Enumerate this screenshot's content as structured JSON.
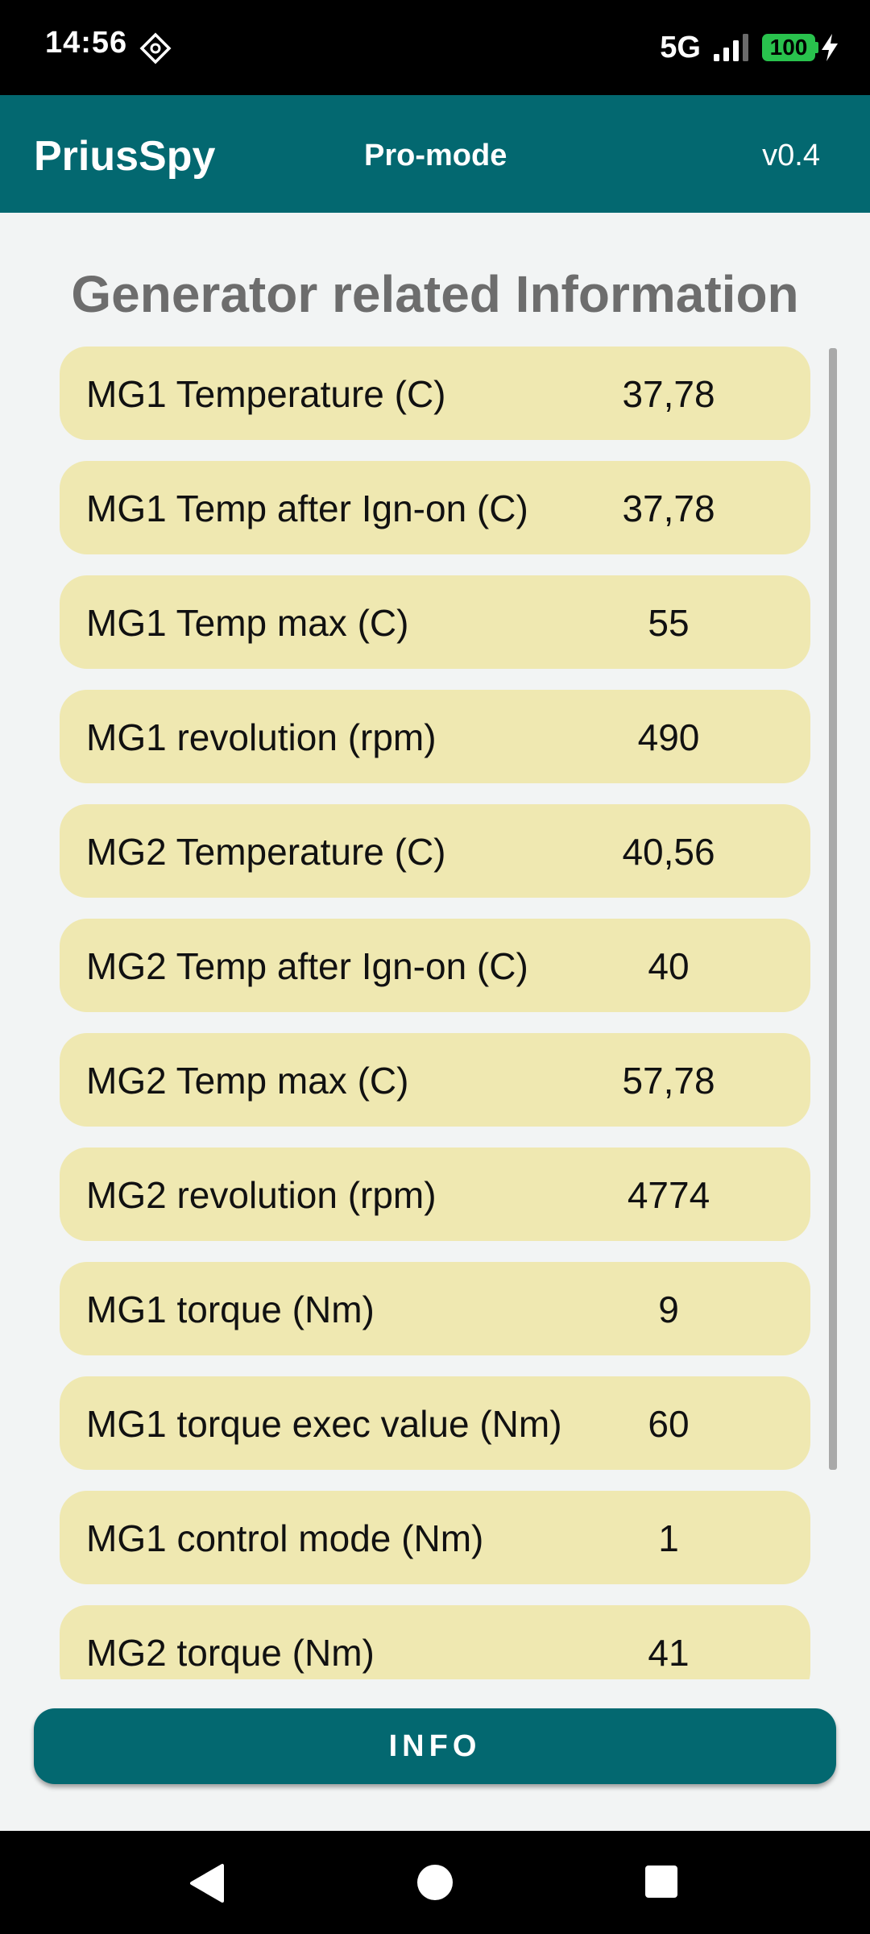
{
  "status_bar": {
    "time": "14:56",
    "network": "5G",
    "battery": "100",
    "icons": [
      "settings-diamond-icon",
      "signal-icon",
      "battery-icon",
      "charging-bolt-icon"
    ]
  },
  "app_bar": {
    "title": "PriusSpy",
    "mode": "Pro-mode",
    "version": "v0.4",
    "color": "#036870"
  },
  "section_title": "Generator related Information",
  "rows": [
    {
      "label": "MG1 Temperature (C)",
      "value": "37,78"
    },
    {
      "label": "MG1 Temp after Ign-on (C)",
      "value": "37,78"
    },
    {
      "label": "MG1 Temp max (C)",
      "value": "55"
    },
    {
      "label": "MG1 revolution (rpm)",
      "value": "490"
    },
    {
      "label": "MG2 Temperature (C)",
      "value": "40,56"
    },
    {
      "label": "MG2 Temp after Ign-on (C)",
      "value": "40"
    },
    {
      "label": "MG2 Temp max (C)",
      "value": "57,78"
    },
    {
      "label": "MG2 revolution (rpm)",
      "value": "4774"
    },
    {
      "label": "MG1 torque (Nm)",
      "value": "9"
    },
    {
      "label": "MG1 torque exec value (Nm)",
      "value": "60"
    },
    {
      "label": "MG1 control mode (Nm)",
      "value": "1"
    },
    {
      "label": "MG2 torque (Nm)",
      "value": "41"
    }
  ],
  "row_color": "#efe8b1",
  "info_button": {
    "label": "INFO"
  },
  "nav_bar": {
    "icons": [
      "back-icon",
      "home-icon",
      "recents-icon"
    ]
  }
}
